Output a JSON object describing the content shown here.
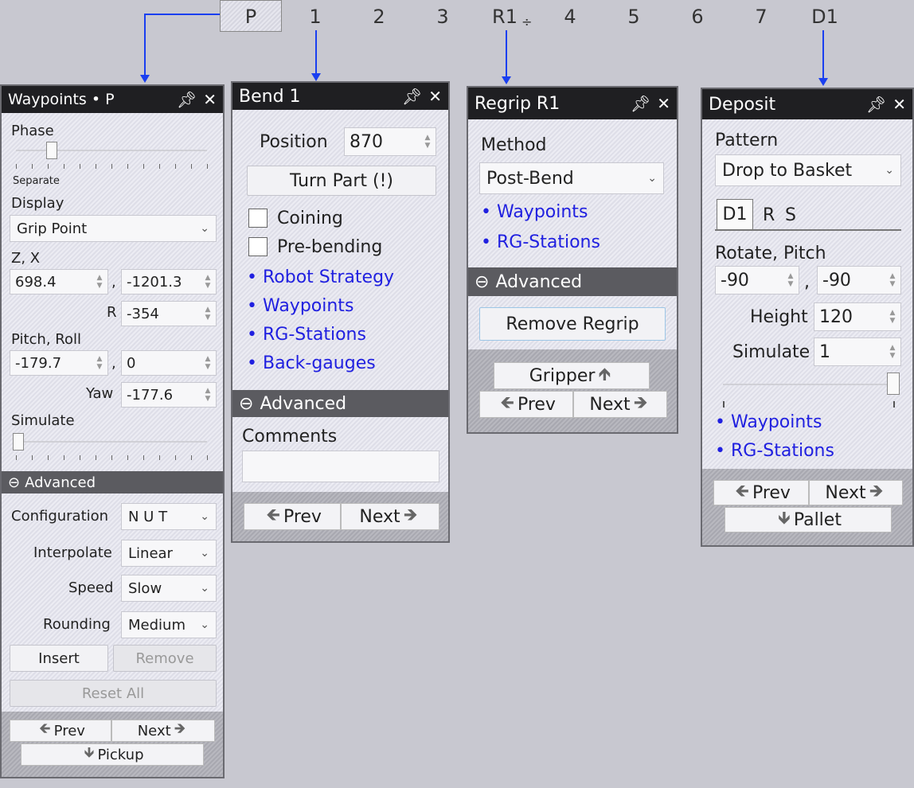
{
  "sequence": {
    "steps": [
      "P",
      "1",
      "2",
      "3",
      "R1",
      "4",
      "5",
      "6",
      "7",
      "D1"
    ],
    "separator_icon": "separator-icon"
  },
  "waypoints": {
    "title": "Waypoints • P",
    "phase_label": "Phase",
    "phase_value_label": "Separate",
    "display_label": "Display",
    "display_value": "Grip Point",
    "zx_label": "Z, X",
    "z_value": "698.4",
    "x_value": "-1201.3",
    "comma": ",",
    "r_label": "R",
    "r_value": "-354",
    "pitch_roll_label": "Pitch, Roll",
    "pitch_value": "-179.7",
    "roll_value": "0",
    "yaw_label": "Yaw",
    "yaw_value": "-177.6",
    "simulate_label": "Simulate",
    "advanced_label": "Advanced",
    "configuration_label": "Configuration",
    "configuration_value": "N U T",
    "interpolate_label": "Interpolate",
    "interpolate_value": "Linear",
    "speed_label": "Speed",
    "speed_value": "Slow",
    "rounding_label": "Rounding",
    "rounding_value": "Medium",
    "insert_label": "Insert",
    "remove_label": "Remove",
    "reset_label": "Reset All",
    "prev_label": "Prev",
    "next_label": "Next",
    "pickup_label": "Pickup"
  },
  "bend": {
    "title": "Bend 1",
    "position_label": "Position",
    "position_value": "870",
    "turn_part_label": "Turn Part (!)",
    "coining_label": "Coining",
    "prebending_label": "Pre-bending",
    "links": [
      "Robot Strategy",
      "Waypoints",
      "RG-Stations",
      "Back-gauges"
    ],
    "advanced_label": "Advanced",
    "comments_label": "Comments",
    "comments_value": "",
    "prev_label": "Prev",
    "next_label": "Next"
  },
  "regrip": {
    "title": "Regrip R1",
    "method_label": "Method",
    "method_value": "Post-Bend",
    "links": [
      "Waypoints",
      "RG-Stations"
    ],
    "advanced_label": "Advanced",
    "remove_label": "Remove Regrip",
    "gripper_label": "Gripper",
    "prev_label": "Prev",
    "next_label": "Next"
  },
  "deposit": {
    "title": "Deposit",
    "pattern_label": "Pattern",
    "pattern_value": "Drop to Basket",
    "tabs": [
      "D1",
      "R",
      "S"
    ],
    "rotate_pitch_label": "Rotate, Pitch",
    "rotate_value": "-90",
    "pitch_value": "-90",
    "comma": ",",
    "height_label": "Height",
    "height_value": "120",
    "simulate_label": "Simulate",
    "simulate_value": "1",
    "links": [
      "Waypoints",
      "RG-Stations"
    ],
    "prev_label": "Prev",
    "next_label": "Next",
    "pallet_label": "Pallet"
  },
  "colors": {
    "title_bg": "#1f1f22",
    "advanced_bg": "#5b5b60",
    "link": "#2020e0",
    "arrow": "#1a3ff0"
  }
}
